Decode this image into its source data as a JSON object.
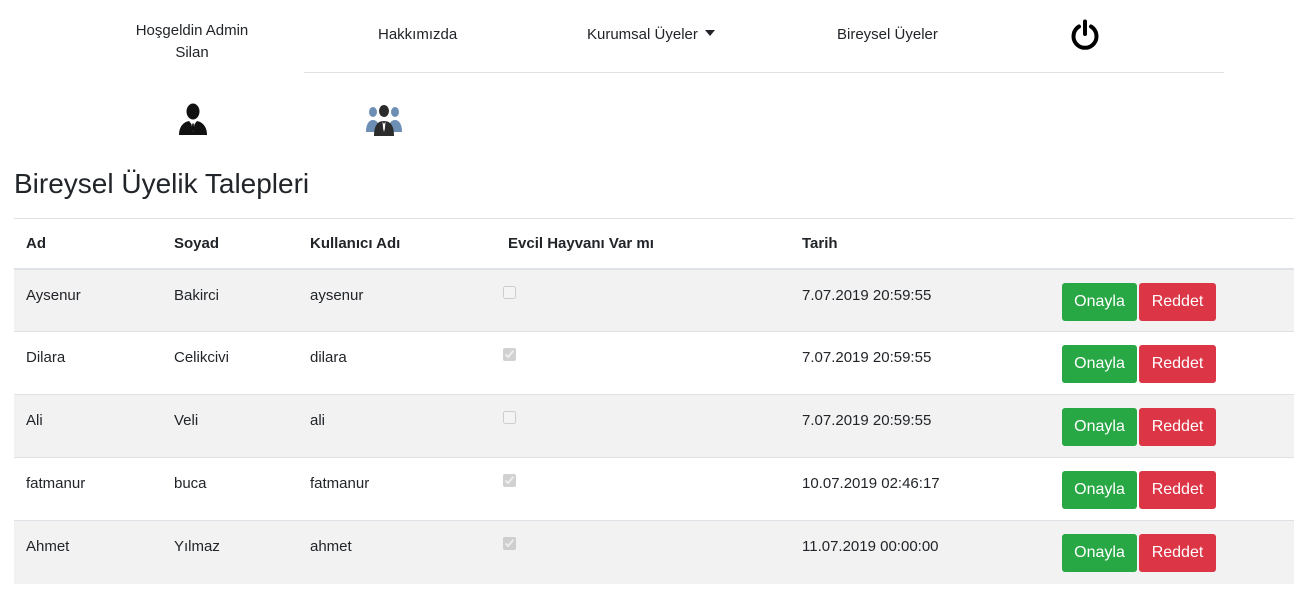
{
  "nav": {
    "welcome_line1": "Hoşgeldin Admin",
    "welcome_line2": "Silan",
    "about": "Hakkımızda",
    "corporate_members": "Kurumsal Üyeler",
    "individual_members": "Bireysel Üyeler",
    "logout_icon": "power-icon"
  },
  "icons": {
    "individual": "person-icon",
    "group": "group-icon"
  },
  "page_title": "Bireysel Üyelik Talepleri",
  "table": {
    "headers": [
      "Ad",
      "Soyad",
      "Kullanıcı Adı",
      "Evcil Hayvanı Var mı",
      "Tarih",
      ""
    ],
    "rows": [
      {
        "ad": "Aysenur",
        "soyad": "Bakirci",
        "kadi": "aysenur",
        "pet": false,
        "tarih": "7.07.2019 20:59:55"
      },
      {
        "ad": "Dilara",
        "soyad": "Celikcivi",
        "kadi": "dilara",
        "pet": true,
        "tarih": "7.07.2019 20:59:55"
      },
      {
        "ad": "Ali",
        "soyad": "Veli",
        "kadi": "ali",
        "pet": false,
        "tarih": "7.07.2019 20:59:55"
      },
      {
        "ad": "fatmanur",
        "soyad": "buca",
        "kadi": "fatmanur",
        "pet": true,
        "tarih": "10.07.2019 02:46:17"
      },
      {
        "ad": "Ahmet",
        "soyad": "Yılmaz",
        "kadi": "ahmet",
        "pet": true,
        "tarih": "11.07.2019 00:00:00"
      }
    ],
    "approve_label": "Onayla",
    "reject_label": "Reddet"
  },
  "colors": {
    "approve": "#28a745",
    "reject": "#dc3545",
    "stripe": "#f2f2f2"
  }
}
